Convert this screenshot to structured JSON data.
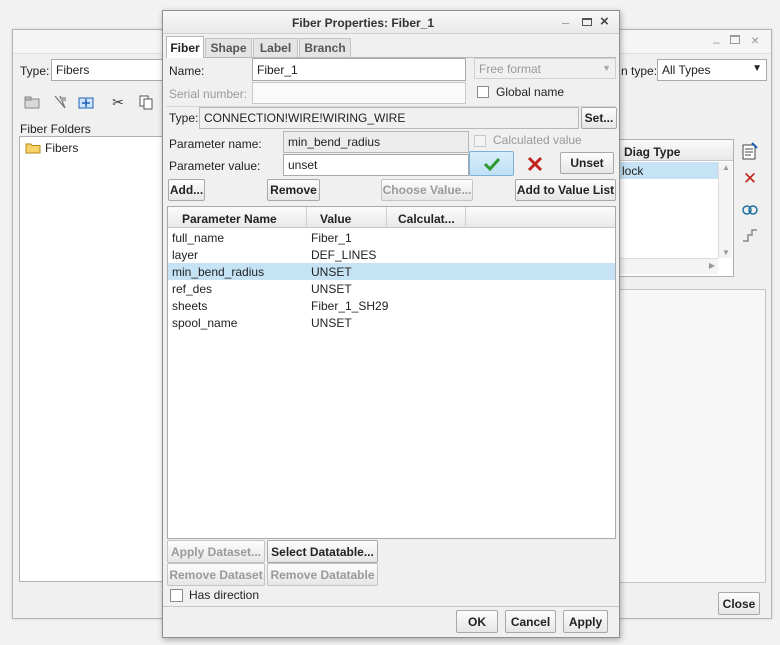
{
  "background_window": {
    "type_label": "Type:",
    "type_value": "Fibers",
    "filter_label_partial": "n type:",
    "filter_value": "All Types",
    "folders_label": "Fiber Folders",
    "tree_item": "Fibers",
    "diag_type_header": "Diag Type",
    "diag_row_value": "lock",
    "close_label": "Close"
  },
  "dialog": {
    "title": "Fiber Properties: Fiber_1",
    "tabs": [
      "Fiber",
      "Shape",
      "Label",
      "Branch"
    ],
    "name_label": "Name:",
    "name_value": "Fiber_1",
    "format_value": "Free format",
    "serial_label": "Serial number:",
    "serial_value": "",
    "global_name_label": "Global name",
    "type_label": "Type:",
    "type_value": "CONNECTION!WIRE!WIRING_WIRE",
    "set_label": "Set...",
    "param_name_label": "Parameter name:",
    "param_name_value": "min_bend_radius",
    "calculated_label": "Calculated value",
    "param_value_label": "Parameter value:",
    "param_value_value": "unset",
    "unset_label": "Unset",
    "add_label": "Add...",
    "remove_label": "Remove",
    "choose_value_label": "Choose Value...",
    "add_to_list_label": "Add to Value List",
    "columns": [
      "Parameter Name",
      "Value",
      "Calculat..."
    ],
    "rows": [
      {
        "name": "full_name",
        "value": "Fiber_1"
      },
      {
        "name": "layer",
        "value": "DEF_LINES"
      },
      {
        "name": "min_bend_radius",
        "value": "UNSET"
      },
      {
        "name": "ref_des",
        "value": "UNSET"
      },
      {
        "name": "sheets",
        "value": "Fiber_1_SH29"
      },
      {
        "name": "spool_name",
        "value": "UNSET"
      }
    ],
    "selected_row": 2,
    "apply_dataset_label": "Apply Dataset...",
    "select_datatable_label": "Select Datatable...",
    "remove_dataset_label": "Remove Dataset",
    "remove_datatable_label": "Remove Datatable",
    "has_direction_label": "Has direction",
    "ok_label": "OK",
    "cancel_label": "Cancel",
    "apply_label": "Apply"
  },
  "colors": {
    "selection": "#c5e3f4",
    "accept_green": "#2e9a2e",
    "reject_red": "#c0241c"
  }
}
